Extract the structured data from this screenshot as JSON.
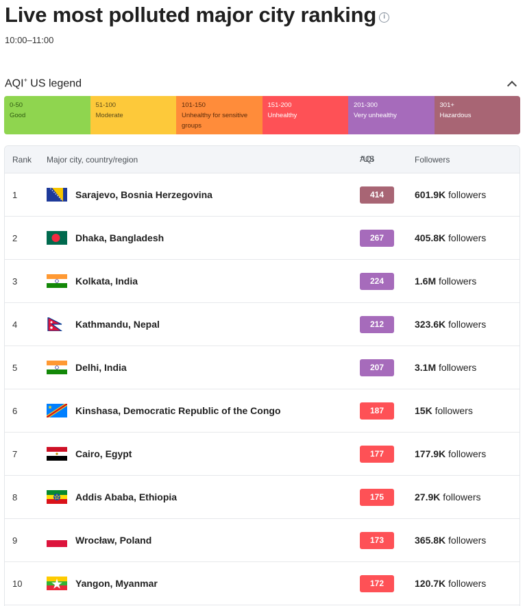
{
  "page": {
    "title": "Live most polluted major city ranking",
    "time_range": "10:00–11:00"
  },
  "legend": {
    "title": "AQI",
    "title_sup": "+",
    "title_suffix": " US legend",
    "segments": [
      {
        "range": "0-50",
        "label": "Good",
        "color": "#8fd54f"
      },
      {
        "range": "51-100",
        "label": "Moderate",
        "color": "#fdc93a"
      },
      {
        "range": "101-150",
        "label": "Unhealthy for sensitive groups",
        "color": "#ff8c3a"
      },
      {
        "range": "151-200",
        "label": "Unhealthy",
        "color": "#fe5156"
      },
      {
        "range": "201-300",
        "label": "Very unhealthy",
        "color": "#a66bbb"
      },
      {
        "range": "301+",
        "label": "Hazardous",
        "color": "#a86574"
      }
    ]
  },
  "table": {
    "headers": {
      "rank": "Rank",
      "city": "Major city, country/region",
      "aqi": "AQI",
      "aqi_sup": "+",
      "aqi_suffix": " US",
      "followers": "Followers"
    },
    "rows": [
      {
        "rank": "1",
        "flag": "bosnia-flag",
        "city": "Sarajevo, Bosnia Herzegovina",
        "aqi": "414",
        "aqi_color": "#a86574",
        "followers_value": "601.9K",
        "followers_suffix": " followers"
      },
      {
        "rank": "2",
        "flag": "bangladesh-flag",
        "city": "Dhaka, Bangladesh",
        "aqi": "267",
        "aqi_color": "#a66bbb",
        "followers_value": "405.8K",
        "followers_suffix": " followers"
      },
      {
        "rank": "3",
        "flag": "india-flag",
        "city": "Kolkata, India",
        "aqi": "224",
        "aqi_color": "#a66bbb",
        "followers_value": "1.6M",
        "followers_suffix": " followers"
      },
      {
        "rank": "4",
        "flag": "nepal-flag",
        "city": "Kathmandu, Nepal",
        "aqi": "212",
        "aqi_color": "#a66bbb",
        "followers_value": "323.6K",
        "followers_suffix": " followers"
      },
      {
        "rank": "5",
        "flag": "india-flag",
        "city": "Delhi, India",
        "aqi": "207",
        "aqi_color": "#a66bbb",
        "followers_value": "3.1M",
        "followers_suffix": " followers"
      },
      {
        "rank": "6",
        "flag": "drc-flag",
        "city": "Kinshasa, Democratic Republic of the Congo",
        "aqi": "187",
        "aqi_color": "#fe5156",
        "followers_value": "15K",
        "followers_suffix": " followers"
      },
      {
        "rank": "7",
        "flag": "egypt-flag",
        "city": "Cairo, Egypt",
        "aqi": "177",
        "aqi_color": "#fe5156",
        "followers_value": "177.9K",
        "followers_suffix": " followers"
      },
      {
        "rank": "8",
        "flag": "ethiopia-flag",
        "city": "Addis Ababa, Ethiopia",
        "aqi": "175",
        "aqi_color": "#fe5156",
        "followers_value": "27.9K",
        "followers_suffix": " followers"
      },
      {
        "rank": "9",
        "flag": "poland-flag",
        "city": "Wrocław, Poland",
        "aqi": "173",
        "aqi_color": "#fe5156",
        "followers_value": "365.8K",
        "followers_suffix": " followers"
      },
      {
        "rank": "10",
        "flag": "myanmar-flag",
        "city": "Yangon, Myanmar",
        "aqi": "172",
        "aqi_color": "#fe5156",
        "followers_value": "120.7K",
        "followers_suffix": " followers"
      }
    ]
  }
}
